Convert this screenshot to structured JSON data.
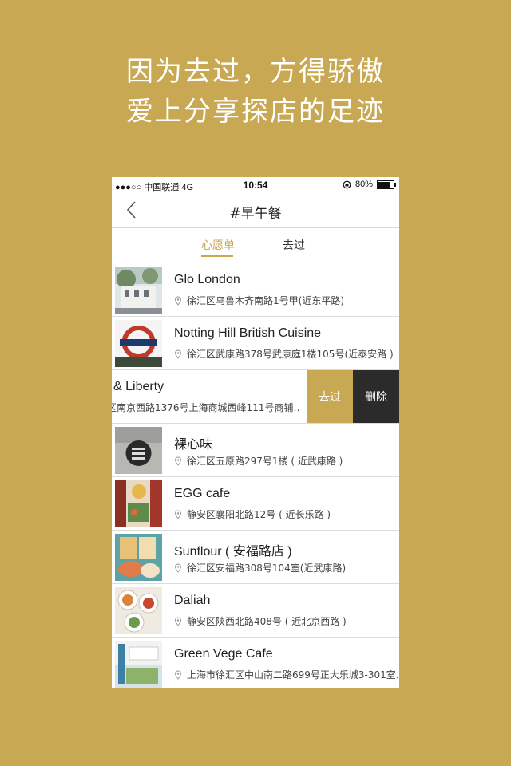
{
  "headline": {
    "line1": "因为去过，方得骄傲",
    "line2": "爱上分享探店的足迹"
  },
  "status_bar": {
    "carrier": "●●●○○ 中国联通  4G",
    "time": "10:54",
    "battery": "80%"
  },
  "nav": {
    "title": "#早午餐",
    "back_icon": "chevron-left-icon"
  },
  "tabs": [
    {
      "label": "心愿单",
      "active": true
    },
    {
      "label": "去过",
      "active": false
    }
  ],
  "items": [
    {
      "name": "Glo London",
      "address": "徐汇区乌鲁木齐南路1号甲(近东平路)"
    },
    {
      "name": "Notting Hill British Cuisine",
      "address": "徐汇区武康路378号武康庭1楼105号(近泰安路 )"
    },
    {
      "name": "& Liberty",
      "address": "区南京西路1376号上海商城西峰111号商铺…"
    },
    {
      "name": "裸心味",
      "address": "徐汇区五原路297号1楼 ( 近武康路 )"
    },
    {
      "name": "EGG cafe",
      "address": "静安区襄阳北路12号 ( 近长乐路 )"
    },
    {
      "name": "Sunflour ( 安福路店 )",
      "address": "徐汇区安福路308号104室(近武康路)"
    },
    {
      "name": "Daliah",
      "address": "静安区陕西北路408号 ( 近北京西路 )"
    },
    {
      "name": "Green Vege Cafe",
      "address": "上海市徐汇区中山南二路699号正大乐城3-301室…"
    }
  ],
  "swipe_actions": {
    "been": "去过",
    "delete": "删除"
  },
  "colors": {
    "accent": "#c8a852",
    "delete_bg": "#2b2b2b"
  }
}
